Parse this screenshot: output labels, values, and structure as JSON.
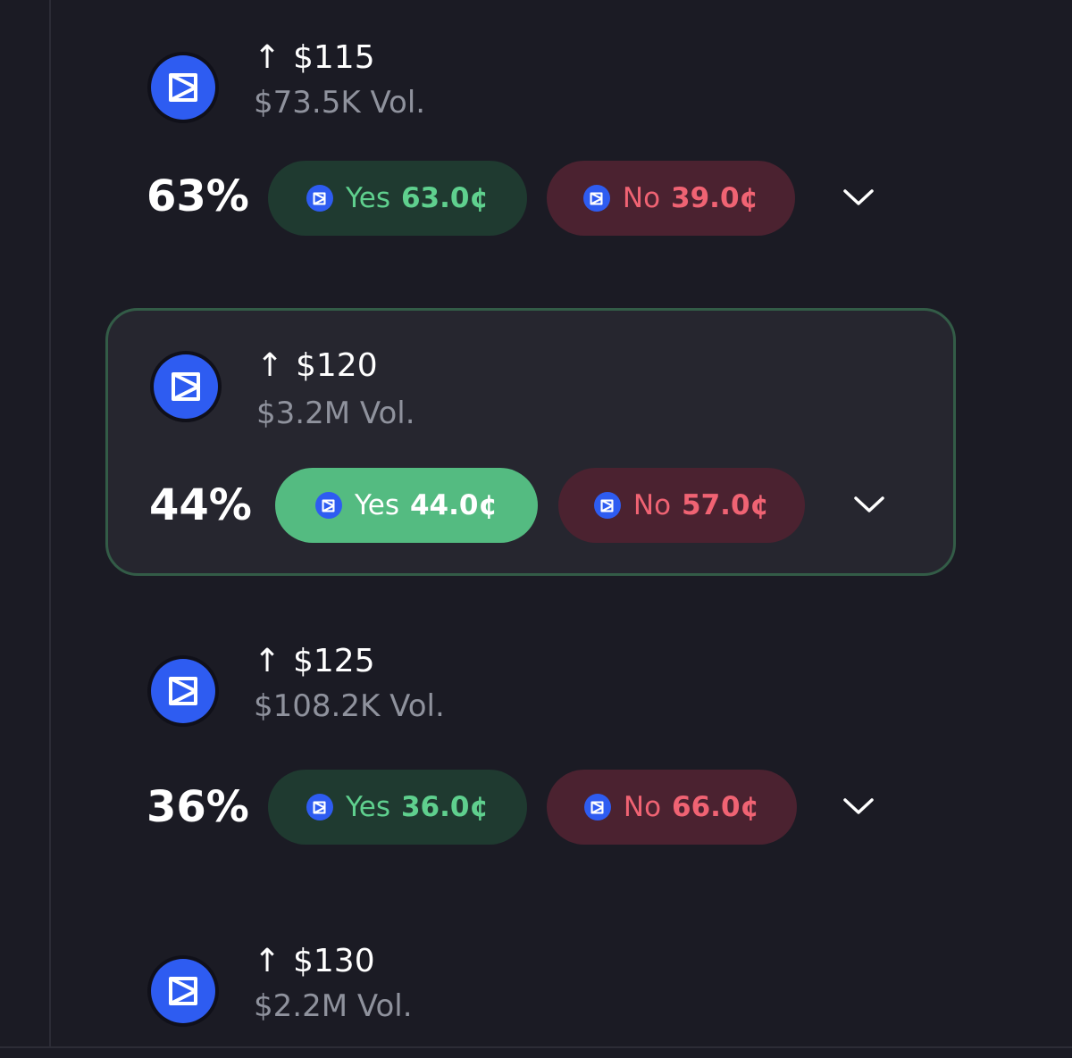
{
  "markets": [
    {
      "title": "$115",
      "volume": "$73.5K Vol.",
      "percent": "63%",
      "yes_label": "Yes",
      "yes_price": "63.0¢",
      "no_label": "No",
      "no_price": "39.0¢",
      "selected": false
    },
    {
      "title": "$120",
      "volume": "$3.2M Vol.",
      "percent": "44%",
      "yes_label": "Yes",
      "yes_price": "44.0¢",
      "no_label": "No",
      "no_price": "57.0¢",
      "selected": true
    },
    {
      "title": "$125",
      "volume": "$108.2K Vol.",
      "percent": "36%",
      "yes_label": "Yes",
      "yes_price": "36.0¢",
      "no_label": "No",
      "no_price": "66.0¢",
      "selected": false
    },
    {
      "title": "$130",
      "volume": "$2.2M Vol."
    }
  ],
  "direction_glyph": "↑",
  "icons": {
    "market_icon": "blue-disc-logo-icon",
    "coin_icon": "blue-coin-icon",
    "expand_icon": "chevron-down-icon"
  },
  "colors": {
    "background": "#1b1b24",
    "logo_blue": "#2e5cf1",
    "yes_green": "#5fd08e",
    "yes_active_bg": "#54bb81",
    "no_red": "#f06373",
    "selected_border": "#335c47"
  }
}
